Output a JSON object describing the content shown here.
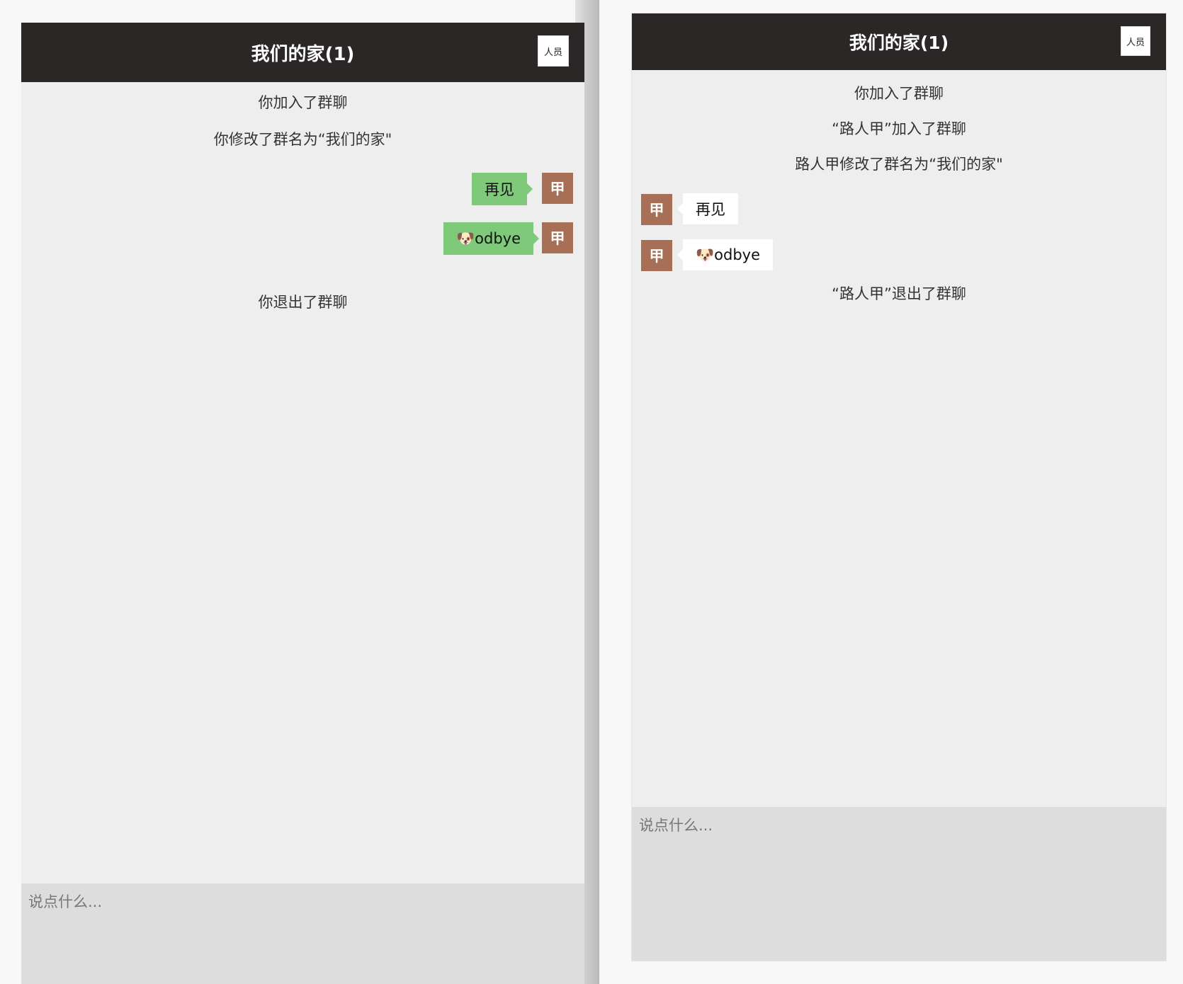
{
  "left": {
    "title": "我们的家(1)",
    "members_label": "人员",
    "system_messages": [
      "你加入了群聊",
      "你修改了群名为“我们的家\"",
      "你退出了群聊"
    ],
    "messages": [
      {
        "avatar": "甲",
        "text": "再见"
      },
      {
        "avatar": "甲",
        "text": "🐶odbye"
      }
    ],
    "input_placeholder": "说点什么..."
  },
  "right": {
    "title": "我们的家(1)",
    "members_label": "人员",
    "system_messages": [
      "你加入了群聊",
      "“路人甲”加入了群聊",
      "路人甲修改了群名为“我们的家\"",
      "“路人甲”退出了群聊"
    ],
    "messages": [
      {
        "avatar": "甲",
        "text": "再见"
      },
      {
        "avatar": "甲",
        "text": "🐶odbye"
      }
    ],
    "input_placeholder": "说点什么..."
  },
  "colors": {
    "header_bg": "#2a2726",
    "chat_bg": "#eeeeee",
    "my_bubble": "#7ec97a",
    "avatar_bg": "#a66f56",
    "input_bg": "#dddddd"
  }
}
